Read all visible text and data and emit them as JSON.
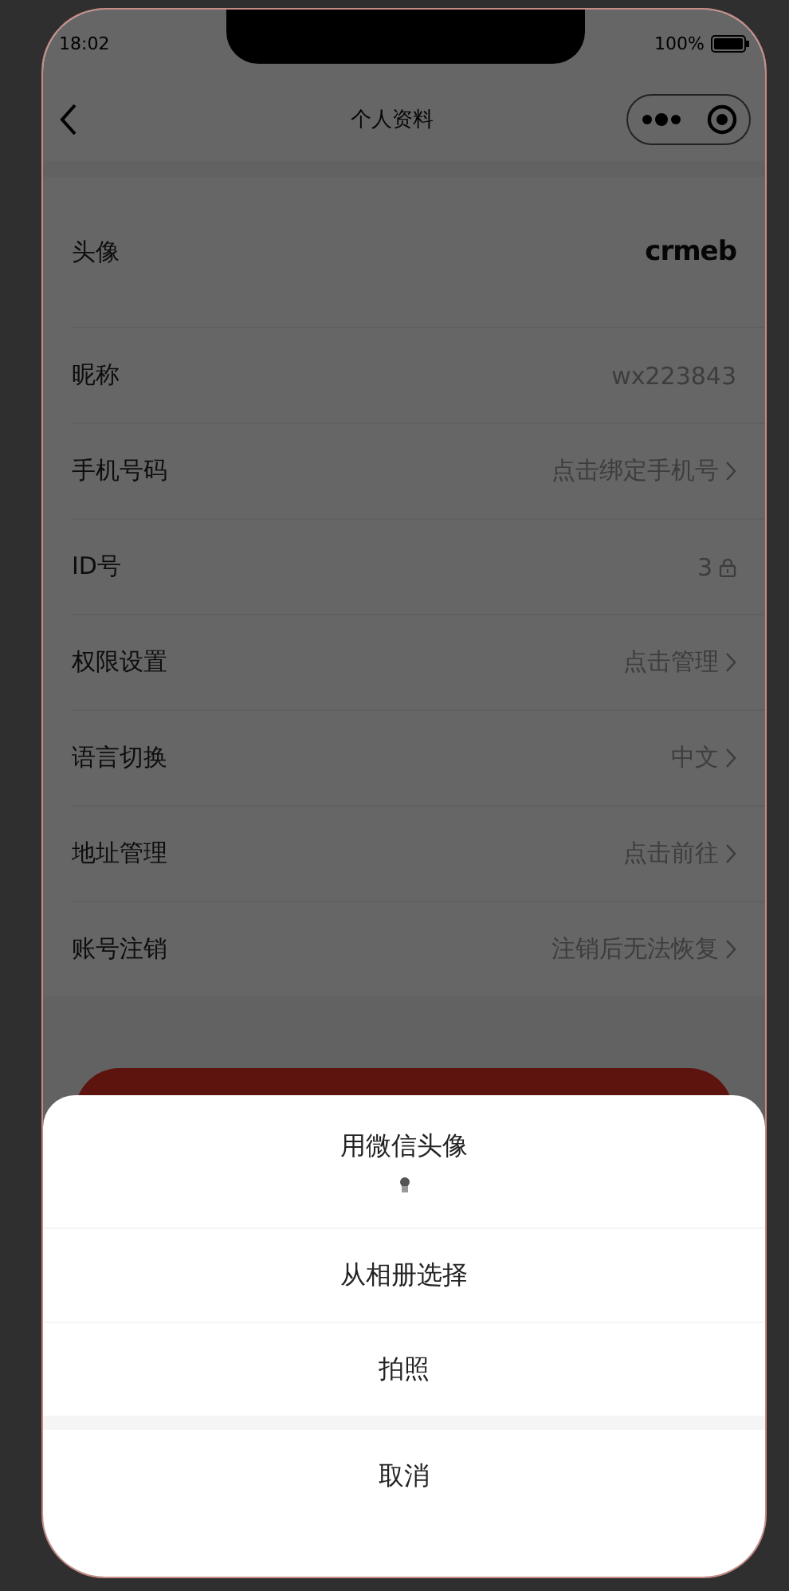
{
  "status_bar": {
    "time": "18:02",
    "battery": "100%"
  },
  "nav": {
    "title": "个人资料"
  },
  "rows": [
    {
      "label": "头像",
      "value": "crmeb",
      "kind": "logo"
    },
    {
      "label": "昵称",
      "value": "wx223843",
      "kind": "text"
    },
    {
      "label": "手机号码",
      "value": "点击绑定手机号",
      "kind": "link"
    },
    {
      "label": "ID号",
      "value": "3",
      "kind": "locked"
    },
    {
      "label": "权限设置",
      "value": "点击管理",
      "kind": "link"
    },
    {
      "label": "语言切换",
      "value": "中文",
      "kind": "link"
    },
    {
      "label": "地址管理",
      "value": "点击前往",
      "kind": "link"
    },
    {
      "label": "账号注销",
      "value": "注销后无法恢复",
      "kind": "link"
    }
  ],
  "action_sheet": {
    "options": [
      {
        "label": "用微信头像",
        "kind": "with_picture"
      },
      {
        "label": "从相册选择",
        "kind": "plain"
      },
      {
        "label": "拍照",
        "kind": "plain"
      }
    ],
    "cancel": "取消"
  }
}
